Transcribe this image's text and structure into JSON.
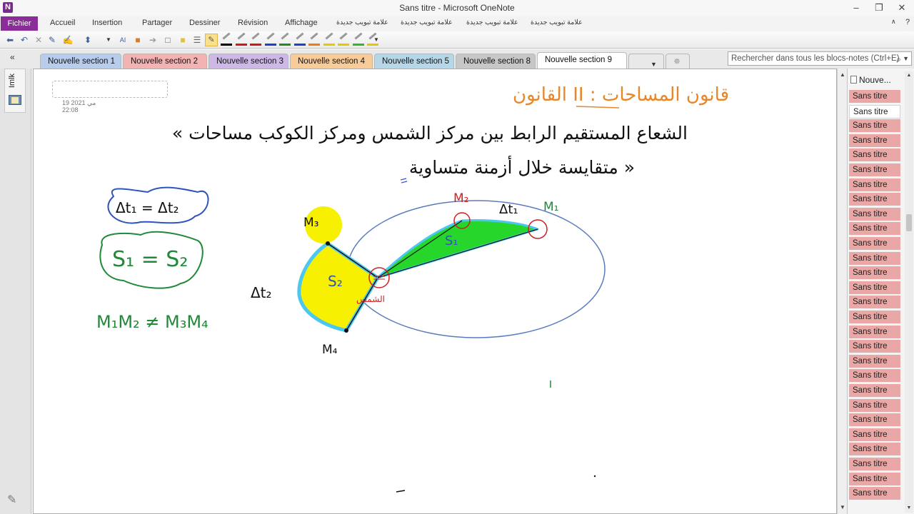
{
  "window": {
    "app_logo": "N",
    "title": "Sans titre  -  Microsoft OneNote",
    "controls": [
      "?",
      "minimize",
      "maximize",
      "close"
    ]
  },
  "ribbon": {
    "file_tab": "Fichier",
    "tabs": [
      "Accueil",
      "Insertion",
      "Partager",
      "Dessiner",
      "Révision",
      "Affichage",
      "علامة تبويب جديدة",
      "علامة تبويب جديدة",
      "علامة تبويب جديدة",
      "علامة تبويب جديدة"
    ],
    "help_icon": "?",
    "collapse_icon": "chevron-up-icon"
  },
  "toolbar": {
    "pen_colors": [
      "#000000",
      "#d01818",
      "#d01818",
      "#1e3fc8",
      "#1e8a2a",
      "#1e3fc8",
      "#f07a10",
      "#e6c800",
      "#e6c800",
      "#2eb82e",
      "#e6c800"
    ]
  },
  "sections": {
    "nav_arrow": "«",
    "tabs": [
      {
        "label": "Nouvelle section 1",
        "color": "#b8cdec"
      },
      {
        "label": "Nouvelle section 2",
        "color": "#f3b3b3"
      },
      {
        "label": "Nouvelle section 3",
        "color": "#cdb8e6"
      },
      {
        "label": "Nouvelle section 4",
        "color": "#f8cc99"
      },
      {
        "label": "Nouvelle section 5",
        "color": "#b6d7e8"
      },
      {
        "label": "Nouvelle section 8",
        "color": "#c7c7c7"
      },
      {
        "label": "Nouvelle section 9",
        "color": "#ffffff",
        "active": true
      }
    ],
    "more_button": "▼",
    "search_placeholder": "Rechercher dans tous les blocs-notes (Ctrl+E)"
  },
  "notebook": {
    "name": "Imlk"
  },
  "page": {
    "date": "19 مي 2021",
    "time": "22:08",
    "ink_text": {
      "heading": "القانون II : قانون المساحات",
      "statement_line1": "« الشعاع المستقيم الرابط بين مركز الشمس ومركز الكوكب مساحات",
      "statement_line2": "متقايسة خلال أزمنة متساوية »",
      "delta_t_equal": "Δt₁ = Δt₂",
      "surface_equal": "S₁ = S₂",
      "distance_unequal": "M₁M₂ ≠ M₃M₄",
      "label_m1": "M₁",
      "label_m2": "M₂",
      "label_m3": "M₃",
      "label_m4": "M₄",
      "label_dt1": "Δt₁",
      "label_dt2": "Δt₂",
      "label_s1": "S₁",
      "label_s2": "S₂",
      "label_sun": "الشمس"
    }
  },
  "pages_panel": {
    "new_page": "Nouve...",
    "pages": [
      "Sans titre",
      "Sans titre",
      "Sans titre",
      "Sans titre",
      "Sans titre",
      "Sans titre",
      "Sans titre",
      "Sans titre",
      "Sans titre",
      "Sans titre",
      "Sans titre",
      "Sans titre",
      "Sans titre",
      "Sans titre",
      "Sans titre",
      "Sans titre",
      "Sans titre",
      "Sans titre",
      "Sans titre",
      "Sans titre",
      "Sans titre",
      "Sans titre",
      "Sans titre",
      "Sans titre",
      "Sans titre",
      "Sans titre",
      "Sans titre",
      "Sans titre"
    ],
    "active_index": 1
  }
}
